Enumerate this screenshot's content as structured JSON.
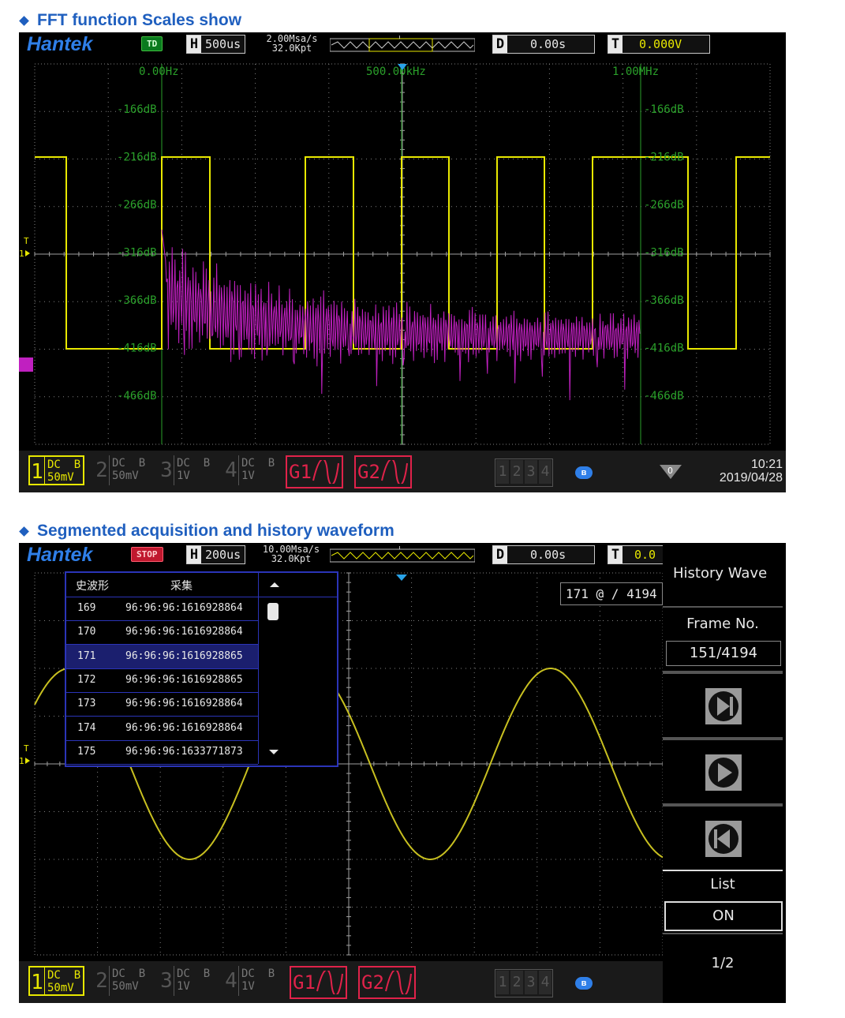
{
  "section1": {
    "title": "FFT function Scales show",
    "brand": "Hantek",
    "mode_badge": "TD",
    "h_letter": "H",
    "timebase": "500us",
    "sample_rate": "2.00Msa/s",
    "memory": "32.0Kpt",
    "d_letter": "D",
    "delay": "0.00s",
    "t_letter": "T",
    "trigger_level": "0.000V",
    "freq_labels": [
      "0.00Hz",
      "500.00kHz",
      "1.00MHz"
    ],
    "db_labels": [
      "-166dB",
      "-216dB",
      "-266dB",
      "-316dB",
      "-366dB",
      "-416dB",
      "-466dB"
    ],
    "channels": [
      {
        "num": "1",
        "coupling": "DC",
        "bw": "B",
        "scale": "50mV"
      },
      {
        "num": "2",
        "coupling": "DC",
        "bw": "B",
        "scale": "50mV"
      },
      {
        "num": "3",
        "coupling": "DC",
        "bw": "B",
        "scale": "1V"
      },
      {
        "num": "4",
        "coupling": "DC",
        "bw": "B",
        "scale": "1V"
      }
    ],
    "gen1": "G1",
    "gen2": "G2",
    "channel_select": [
      "1",
      "2",
      "3",
      "4"
    ],
    "usb_count": "0",
    "time": "10:21",
    "date": "2019/04/28"
  },
  "section2": {
    "title": "Segmented acquisition and history waveform",
    "brand": "Hantek",
    "mode_badge": "STOP",
    "h_letter": "H",
    "timebase": "200us",
    "sample_rate": "10.00Msa/s",
    "memory": "32.0Kpt",
    "d_letter": "D",
    "delay": "0.00s",
    "t_letter": "T",
    "trigger_level": "0.0",
    "table_headers": [
      "史波形",
      "采集"
    ],
    "table_rows": [
      {
        "idx": "169",
        "time": "96:96:96:1616928864"
      },
      {
        "idx": "170",
        "time": "96:96:96:1616928864"
      },
      {
        "idx": "171",
        "time": "96:96:96:1616928865"
      },
      {
        "idx": "172",
        "time": "96:96:96:1616928865"
      },
      {
        "idx": "173",
        "time": "96:96:96:1616928864"
      },
      {
        "idx": "174",
        "time": "96:96:96:1616928864"
      },
      {
        "idx": "175",
        "time": "96:96:96:1633771873"
      }
    ],
    "frame_counter": "171 @ / 4194",
    "side_title": "History Wave",
    "frame_no_label": "Frame No.",
    "frame_no_value": "151/4194",
    "list_label": "List",
    "list_value": "ON",
    "page": "1/2",
    "channels": [
      {
        "num": "1",
        "coupling": "DC",
        "bw": "B",
        "scale": "50mV"
      },
      {
        "num": "2",
        "coupling": "DC",
        "bw": "B",
        "scale": "50mV"
      },
      {
        "num": "3",
        "coupling": "DC",
        "bw": "B",
        "scale": "1V"
      },
      {
        "num": "4",
        "coupling": "DC",
        "bw": "B",
        "scale": "1V"
      }
    ],
    "gen1": "G1",
    "gen2": "G2",
    "channel_select": [
      "1",
      "2",
      "3",
      "4"
    ]
  },
  "colors": {
    "ch1": "#e8e800",
    "math": "#c020c0",
    "grid": "#808080",
    "fft_grid": "#2aa02a",
    "accent_blue": "#2f7fe8",
    "gen_red": "#e0224a",
    "title_blue": "#1f5fbf"
  },
  "icons": [
    "trigger-marker-icon",
    "next-frame-icon",
    "play-icon",
    "prev-frame-icon",
    "scroll-up-icon",
    "scroll-down-icon",
    "bluetooth-icon",
    "usb-icon"
  ]
}
